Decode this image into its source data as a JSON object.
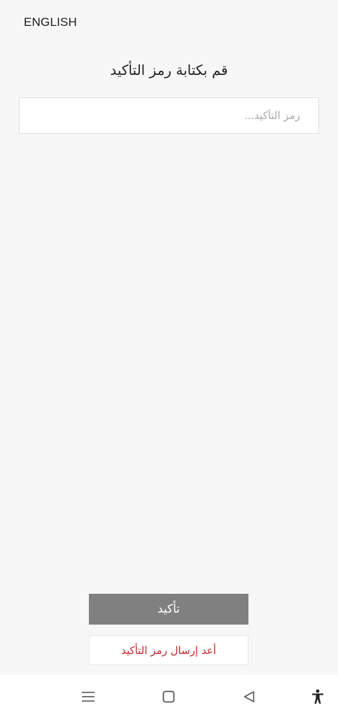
{
  "header": {
    "language_toggle": "ENGLISH"
  },
  "main": {
    "title": "قم بكتابة رمز التأكيد",
    "code_input": {
      "placeholder": "رمز التأكيد...",
      "value": ""
    },
    "confirm_label": "تأكيد",
    "resend_label": "أعد إرسال رمز التأكيد"
  },
  "nav_bar": {
    "icons": [
      "menu-icon",
      "home-icon",
      "back-icon",
      "accessibility-icon"
    ]
  },
  "colors": {
    "background": "#f7f7f7",
    "confirm_button": "#808080",
    "resend_text": "#c1272d"
  }
}
